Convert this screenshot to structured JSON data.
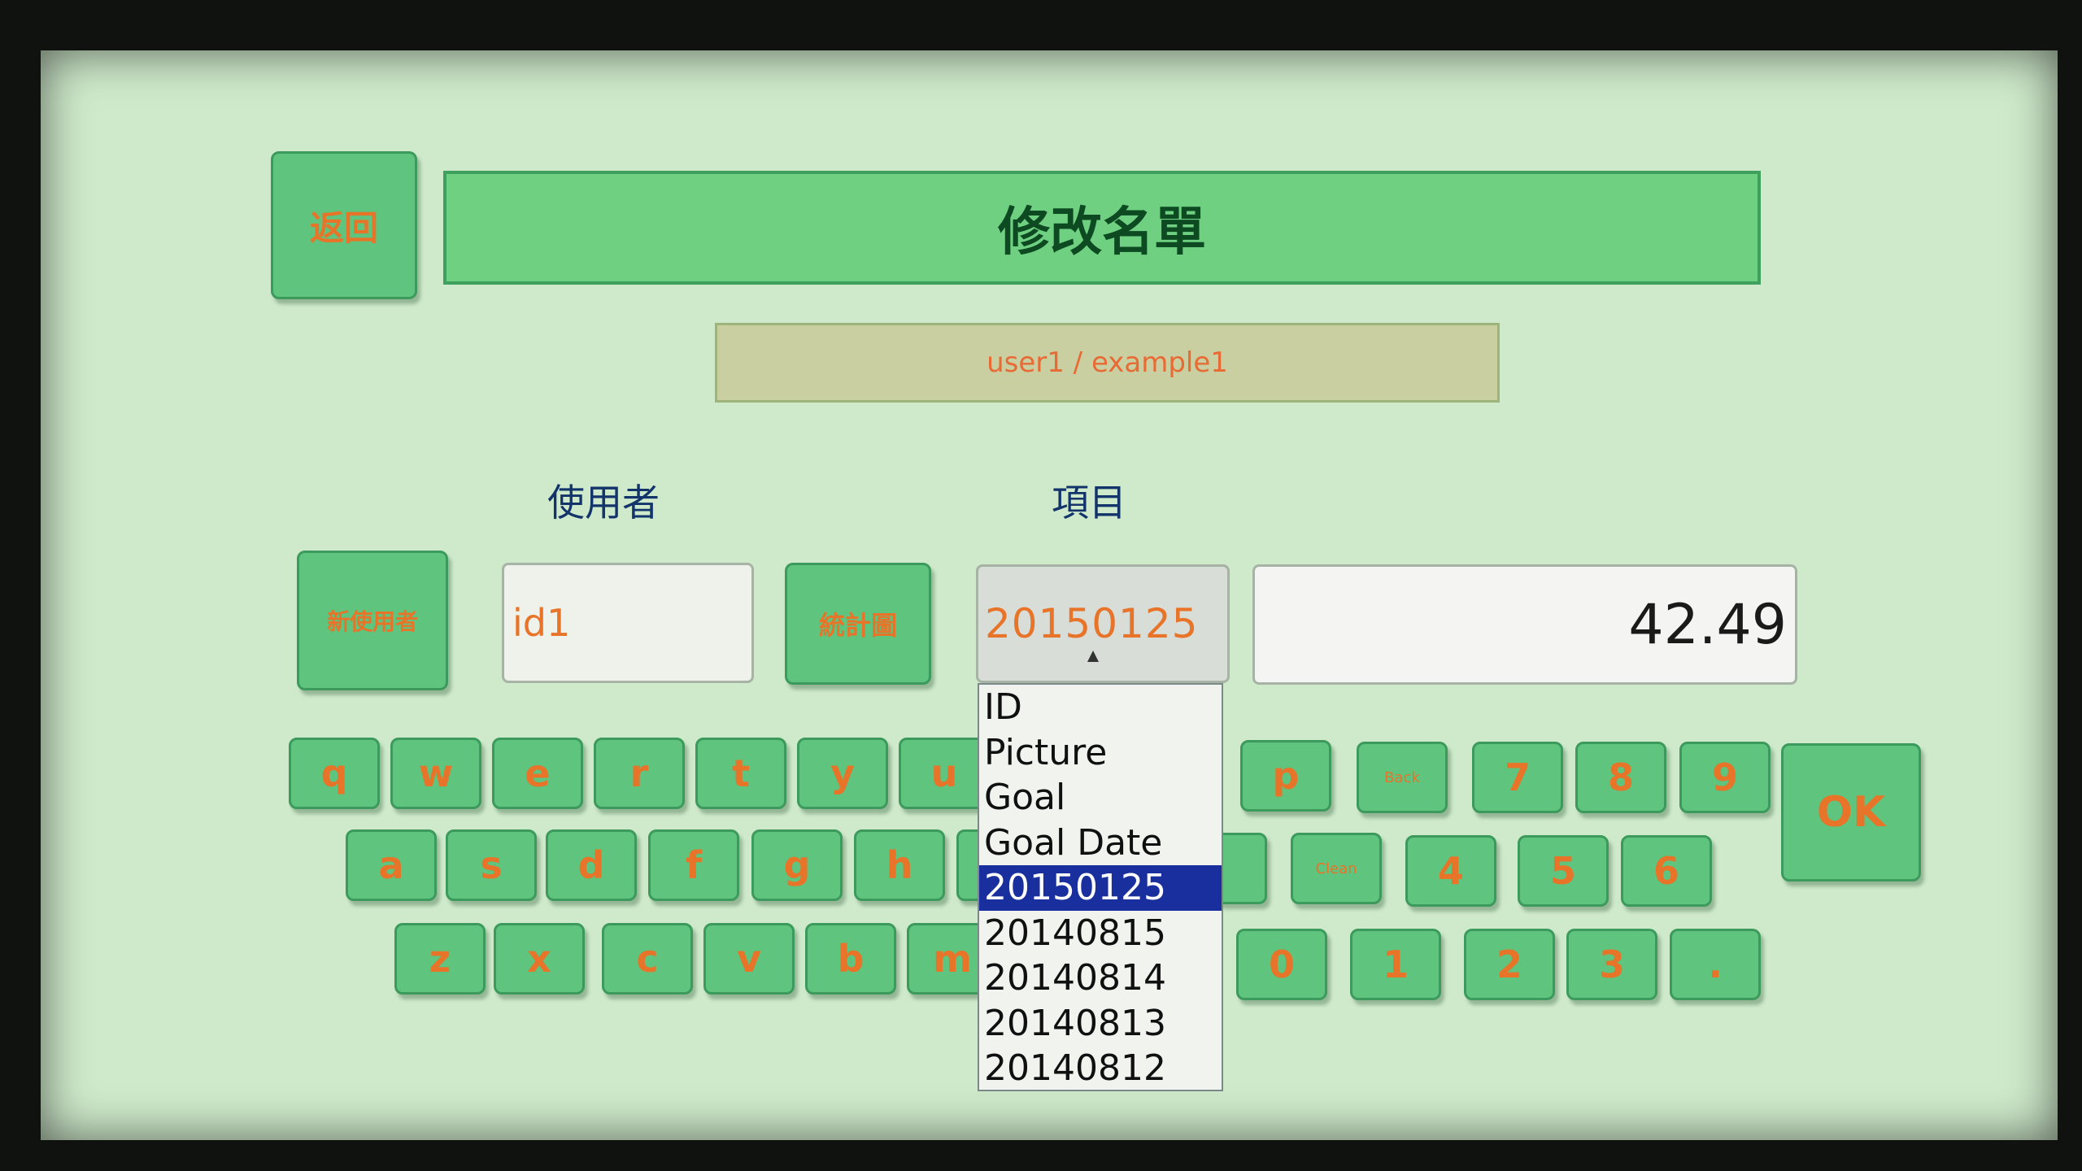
{
  "header": {
    "back_label": "返回",
    "title": "修改名單"
  },
  "user_display": "user1 / example1",
  "labels": {
    "user": "使用者",
    "item": "項目"
  },
  "buttons": {
    "new_user": "新使用者",
    "stats": "統計圖",
    "ok": "OK",
    "back": "Back",
    "clean": "Clean"
  },
  "user_field": {
    "value": "id1"
  },
  "item_select": {
    "value": "20150125",
    "options": [
      "ID",
      "Picture",
      "Goal",
      "Goal Date",
      "20150125",
      "20140815",
      "20140814",
      "20140813",
      "20140812"
    ],
    "selected_index": 4
  },
  "value_field": {
    "value": "42.49"
  },
  "keyboard": {
    "row1": [
      "q",
      "w",
      "e",
      "r",
      "t",
      "y",
      "u",
      "p"
    ],
    "row2": [
      "a",
      "s",
      "d",
      "f",
      "g",
      "h"
    ],
    "row3": [
      "z",
      "x",
      "c",
      "v",
      "b",
      "m"
    ],
    "numpad_row1": [
      "7",
      "8",
      "9"
    ],
    "numpad_row2": [
      "4",
      "5",
      "6"
    ],
    "numpad_row3": [
      "0",
      "1",
      "2",
      "3",
      "."
    ]
  },
  "colors": {
    "accent_text": "#e8742a",
    "button_bg": "#5ec47e",
    "screen_bg": "#cfeacb",
    "selection": "#1a2f9e"
  }
}
